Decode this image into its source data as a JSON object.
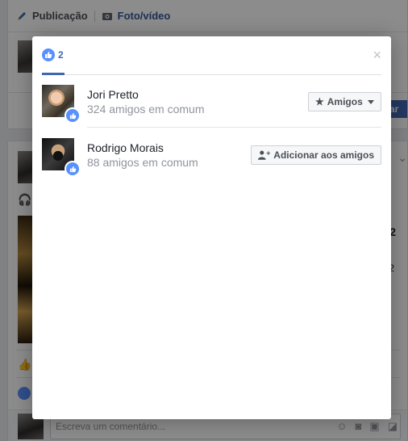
{
  "composer": {
    "tab_post": "Publicação",
    "tab_photo": "Foto/vídeo",
    "publish_partial": "ar"
  },
  "feed": {
    "side_value_1": "2",
    "side_value_2": "2",
    "comment_placeholder": "Escreva um comentário..."
  },
  "modal": {
    "reaction_count": "2",
    "close_glyph": "×",
    "people": [
      {
        "name": "Jori Pretto",
        "mutual": "324 amigos em comum",
        "button_label": "Amigos",
        "button_type": "friends"
      },
      {
        "name": "Rodrigo Morais",
        "mutual": "88 amigos em comum",
        "button_label": "Adicionar aos amigos",
        "button_type": "add-friend"
      }
    ]
  },
  "colors": {
    "accent": "#4267b2",
    "like_blue": "#5890ff",
    "muted_text": "#90949c"
  }
}
